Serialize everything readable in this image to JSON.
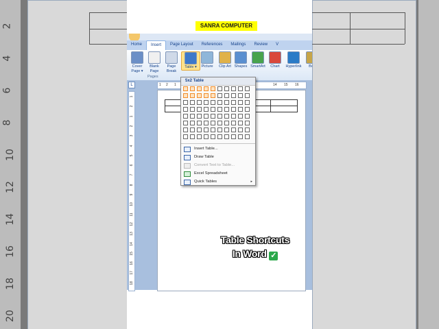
{
  "overlay": {
    "channel": "SANRA COMPUTER",
    "caption_line1": "Table Shortcuts",
    "caption_line2": "In Word",
    "caption_emoji": "✓"
  },
  "ribbon": {
    "tabs": [
      "Home",
      "Insert",
      "Page Layout",
      "References",
      "Mailings",
      "Review",
      "V"
    ],
    "active_tab": "Insert",
    "buttons": [
      {
        "label": "Cover Page ▾",
        "icon": "cover-page-icon"
      },
      {
        "label": "Blank Page",
        "icon": "blank-page-icon"
      },
      {
        "label": "Page Break",
        "icon": "page-break-icon"
      },
      {
        "label": "Table ▾",
        "icon": "table-icon"
      },
      {
        "label": "Picture",
        "icon": "picture-icon"
      },
      {
        "label": "Clip Art",
        "icon": "clip-art-icon"
      },
      {
        "label": "Shapes",
        "icon": "shapes-icon"
      },
      {
        "label": "SmartArt",
        "icon": "smartart-icon"
      },
      {
        "label": "Chart",
        "icon": "chart-icon"
      },
      {
        "label": "Hyperlink",
        "icon": "hyperlink-icon"
      },
      {
        "label": "Boo",
        "icon": "bookmark-icon"
      }
    ],
    "group_pages": "Pages"
  },
  "table_menu": {
    "title": "5x2 Table",
    "grid_cols": 10,
    "grid_rows": 8,
    "selected_cols": 5,
    "selected_rows": 2,
    "items": [
      {
        "label": "Insert Table...",
        "enabled": true
      },
      {
        "label": "Draw Table",
        "enabled": true
      },
      {
        "label": "Convert Text to Table...",
        "enabled": false
      },
      {
        "label": "Excel Spreadsheet",
        "enabled": true
      },
      {
        "label": "Quick Tables",
        "enabled": true
      }
    ]
  },
  "ruler": {
    "vertical": [
      "1",
      "2",
      "1",
      "2",
      "3",
      "4",
      "5",
      "6",
      "7",
      "8",
      "9",
      "10",
      "11",
      "12",
      "13",
      "14",
      "15",
      "16",
      "17",
      "18"
    ],
    "horizontal": [
      "1",
      "2",
      "1",
      "14",
      "15",
      "16"
    ]
  },
  "background": {
    "left_numbers": [
      "2",
      "4",
      "6",
      "8",
      "10",
      "12",
      "14",
      "16",
      "18",
      "20"
    ]
  }
}
